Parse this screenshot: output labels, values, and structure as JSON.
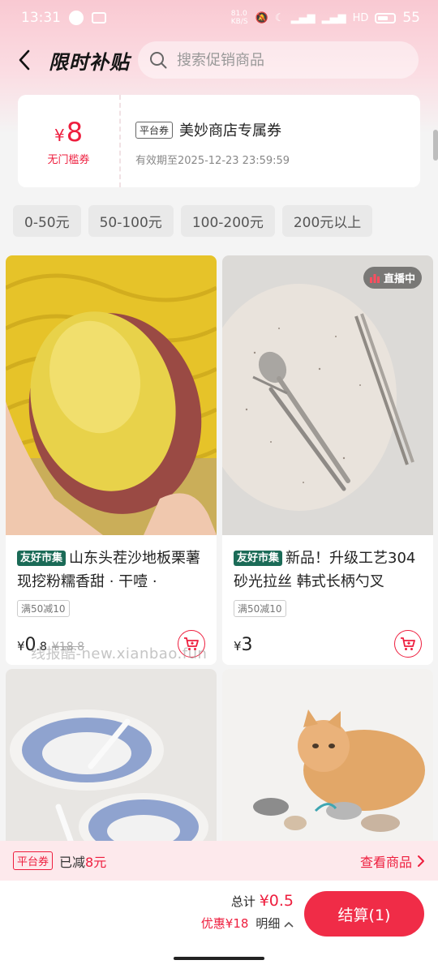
{
  "status": {
    "time": "13:31",
    "network_speed": "81.0 KB/S",
    "network_type": "HD",
    "battery": "55"
  },
  "header": {
    "title": "限时补贴",
    "search_placeholder": "搜索促销商品"
  },
  "coupon": {
    "currency": "¥",
    "amount": "8",
    "condition": "无门槛券",
    "type_tag": "平台券",
    "title": "美妙商店专属券",
    "validity": "有效期至2025-12-23 23:59:59"
  },
  "price_filters": [
    "0-50元",
    "50-100元",
    "100-200元",
    "200元以上"
  ],
  "products": [
    {
      "tag": "友好市集",
      "title": "山东头茬沙地板栗薯现挖粉糯香甜 · 干噎 ·",
      "discount_tag": "满50减10",
      "currency": "¥",
      "price_int": "0",
      "price_dec": ".8",
      "original_price": "¥18.8"
    },
    {
      "live_badge": "直播中",
      "tag": "友好市集",
      "title": "新品！升级工艺304砂光拉丝 韩式长柄勺叉",
      "discount_tag": "满50减10",
      "currency": "¥",
      "price_int": "3",
      "price_dec": "",
      "original_price": ""
    }
  ],
  "watermark": "线报酷-new.xianbao.fun",
  "coupon_bar": {
    "tag": "平台券",
    "reduced_label": "已减",
    "reduced_value": "8元",
    "view_products": "查看商品"
  },
  "footer": {
    "total_label": "总计",
    "total_value": "¥0.5",
    "discount_label": "优惠",
    "discount_value": "¥18",
    "detail_label": "明细",
    "checkout_label": "结算(1)"
  },
  "colors": {
    "accent": "#ee1e3e",
    "market_tag": "#1b6b57",
    "header_pink": "#f9c9d2"
  }
}
